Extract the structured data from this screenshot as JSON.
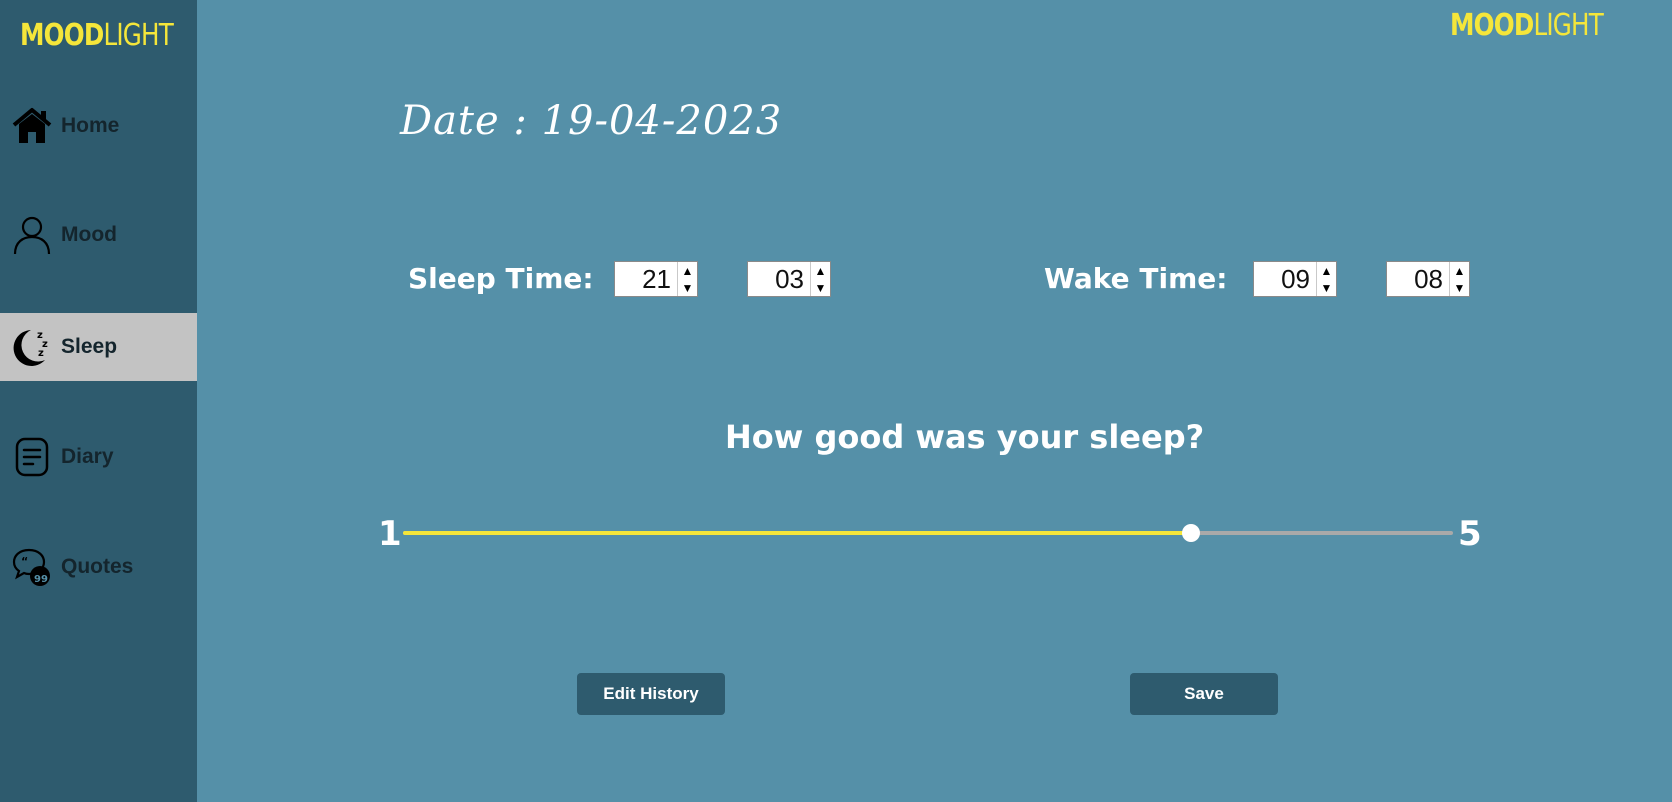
{
  "logo": {
    "part1": "MOOD",
    "part2": "LIGHT"
  },
  "nav": [
    {
      "label": "Home",
      "icon": "home-icon"
    },
    {
      "label": "Mood",
      "icon": "person-icon"
    },
    {
      "label": "Sleep",
      "icon": "moon-zzz-icon",
      "active": true
    },
    {
      "label": "Diary",
      "icon": "notes-icon"
    },
    {
      "label": "Quotes",
      "icon": "quotes-icon"
    }
  ],
  "date_text": "Date : 19-04-2023",
  "sleep": {
    "label": "Sleep Time:",
    "hour": "21",
    "minute": "03"
  },
  "wake": {
    "label": "Wake Time:",
    "hour": "09",
    "minute": "08"
  },
  "question": "How good was your sleep?",
  "rating": {
    "min": "1",
    "max": "5",
    "value": 4
  },
  "buttons": {
    "edit_history": "Edit History",
    "save": "Save"
  },
  "colors": {
    "background": "#5590a8",
    "sidebar": "#2e5b6e",
    "accent": "#f5e63a",
    "active_nav": "#c3c3c3"
  }
}
